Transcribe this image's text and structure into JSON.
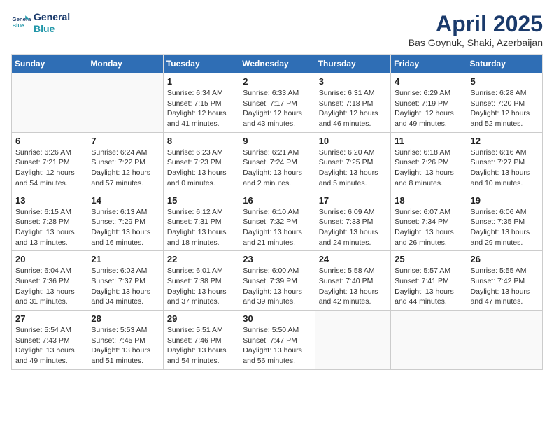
{
  "logo": {
    "line1": "General",
    "line2": "Blue"
  },
  "title": "April 2025",
  "subtitle": "Bas Goynuk, Shaki, Azerbaijan",
  "days_of_week": [
    "Sunday",
    "Monday",
    "Tuesday",
    "Wednesday",
    "Thursday",
    "Friday",
    "Saturday"
  ],
  "weeks": [
    [
      {
        "day": "",
        "info": ""
      },
      {
        "day": "",
        "info": ""
      },
      {
        "day": "1",
        "info": "Sunrise: 6:34 AM\nSunset: 7:15 PM\nDaylight: 12 hours and 41 minutes."
      },
      {
        "day": "2",
        "info": "Sunrise: 6:33 AM\nSunset: 7:17 PM\nDaylight: 12 hours and 43 minutes."
      },
      {
        "day": "3",
        "info": "Sunrise: 6:31 AM\nSunset: 7:18 PM\nDaylight: 12 hours and 46 minutes."
      },
      {
        "day": "4",
        "info": "Sunrise: 6:29 AM\nSunset: 7:19 PM\nDaylight: 12 hours and 49 minutes."
      },
      {
        "day": "5",
        "info": "Sunrise: 6:28 AM\nSunset: 7:20 PM\nDaylight: 12 hours and 52 minutes."
      }
    ],
    [
      {
        "day": "6",
        "info": "Sunrise: 6:26 AM\nSunset: 7:21 PM\nDaylight: 12 hours and 54 minutes."
      },
      {
        "day": "7",
        "info": "Sunrise: 6:24 AM\nSunset: 7:22 PM\nDaylight: 12 hours and 57 minutes."
      },
      {
        "day": "8",
        "info": "Sunrise: 6:23 AM\nSunset: 7:23 PM\nDaylight: 13 hours and 0 minutes."
      },
      {
        "day": "9",
        "info": "Sunrise: 6:21 AM\nSunset: 7:24 PM\nDaylight: 13 hours and 2 minutes."
      },
      {
        "day": "10",
        "info": "Sunrise: 6:20 AM\nSunset: 7:25 PM\nDaylight: 13 hours and 5 minutes."
      },
      {
        "day": "11",
        "info": "Sunrise: 6:18 AM\nSunset: 7:26 PM\nDaylight: 13 hours and 8 minutes."
      },
      {
        "day": "12",
        "info": "Sunrise: 6:16 AM\nSunset: 7:27 PM\nDaylight: 13 hours and 10 minutes."
      }
    ],
    [
      {
        "day": "13",
        "info": "Sunrise: 6:15 AM\nSunset: 7:28 PM\nDaylight: 13 hours and 13 minutes."
      },
      {
        "day": "14",
        "info": "Sunrise: 6:13 AM\nSunset: 7:29 PM\nDaylight: 13 hours and 16 minutes."
      },
      {
        "day": "15",
        "info": "Sunrise: 6:12 AM\nSunset: 7:31 PM\nDaylight: 13 hours and 18 minutes."
      },
      {
        "day": "16",
        "info": "Sunrise: 6:10 AM\nSunset: 7:32 PM\nDaylight: 13 hours and 21 minutes."
      },
      {
        "day": "17",
        "info": "Sunrise: 6:09 AM\nSunset: 7:33 PM\nDaylight: 13 hours and 24 minutes."
      },
      {
        "day": "18",
        "info": "Sunrise: 6:07 AM\nSunset: 7:34 PM\nDaylight: 13 hours and 26 minutes."
      },
      {
        "day": "19",
        "info": "Sunrise: 6:06 AM\nSunset: 7:35 PM\nDaylight: 13 hours and 29 minutes."
      }
    ],
    [
      {
        "day": "20",
        "info": "Sunrise: 6:04 AM\nSunset: 7:36 PM\nDaylight: 13 hours and 31 minutes."
      },
      {
        "day": "21",
        "info": "Sunrise: 6:03 AM\nSunset: 7:37 PM\nDaylight: 13 hours and 34 minutes."
      },
      {
        "day": "22",
        "info": "Sunrise: 6:01 AM\nSunset: 7:38 PM\nDaylight: 13 hours and 37 minutes."
      },
      {
        "day": "23",
        "info": "Sunrise: 6:00 AM\nSunset: 7:39 PM\nDaylight: 13 hours and 39 minutes."
      },
      {
        "day": "24",
        "info": "Sunrise: 5:58 AM\nSunset: 7:40 PM\nDaylight: 13 hours and 42 minutes."
      },
      {
        "day": "25",
        "info": "Sunrise: 5:57 AM\nSunset: 7:41 PM\nDaylight: 13 hours and 44 minutes."
      },
      {
        "day": "26",
        "info": "Sunrise: 5:55 AM\nSunset: 7:42 PM\nDaylight: 13 hours and 47 minutes."
      }
    ],
    [
      {
        "day": "27",
        "info": "Sunrise: 5:54 AM\nSunset: 7:43 PM\nDaylight: 13 hours and 49 minutes."
      },
      {
        "day": "28",
        "info": "Sunrise: 5:53 AM\nSunset: 7:45 PM\nDaylight: 13 hours and 51 minutes."
      },
      {
        "day": "29",
        "info": "Sunrise: 5:51 AM\nSunset: 7:46 PM\nDaylight: 13 hours and 54 minutes."
      },
      {
        "day": "30",
        "info": "Sunrise: 5:50 AM\nSunset: 7:47 PM\nDaylight: 13 hours and 56 minutes."
      },
      {
        "day": "",
        "info": ""
      },
      {
        "day": "",
        "info": ""
      },
      {
        "day": "",
        "info": ""
      }
    ]
  ]
}
